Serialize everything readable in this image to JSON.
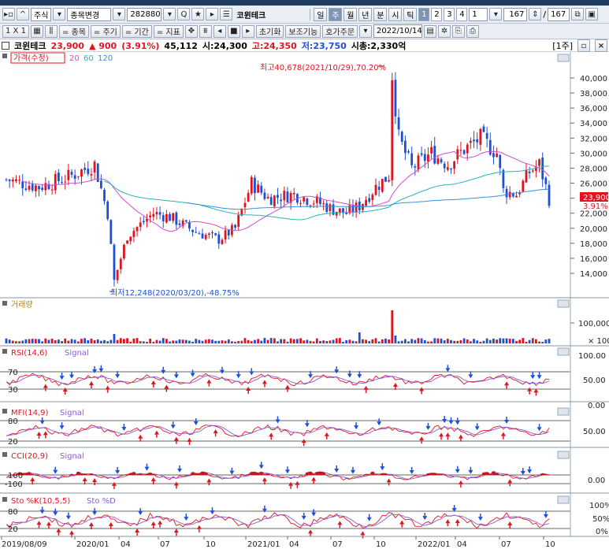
{
  "toolbar1": {
    "market": "주식",
    "search_label": "종목변경",
    "code": "282880",
    "stock_name": "코윈테크",
    "periods": [
      "일",
      "주",
      "월",
      "년",
      "분",
      "시",
      "틱"
    ],
    "active_period": "주",
    "nums": [
      "1",
      "2",
      "3",
      "4"
    ],
    "num_value": "1",
    "count_value": "167",
    "count_total": "167"
  },
  "toolbar2": {
    "ratio": "1 X 1",
    "item_btn": "= 종목",
    "period_btn": "= 주기",
    "range_btn": "= 기간",
    "indicator_btn": "= 지표",
    "reset_btn": "초기화",
    "aux_btn": "보조기능",
    "order_btn": "호가주문",
    "date_value": "2022/10/14"
  },
  "infobar": {
    "name": "코윈테크",
    "price": "23,900",
    "change": "▲ 900",
    "pct": "(3.91%)",
    "volume": "45,112",
    "open": "시:24,300",
    "high": "고:24,350",
    "low": "저:23,750",
    "mcap": "시총:2,330억",
    "period_tag": "[1주]"
  },
  "price_panel": {
    "legend_price": "가격(수정)",
    "ma": [
      "20",
      "60",
      "120"
    ],
    "max_annotation": "최고40,678(2021/10/29),70.20%",
    "min_annotation": "최저12,248(2020/03/20),-48.75%",
    "last_price": "23,900",
    "last_pct": "3.91%",
    "yticks": [
      "40,000",
      "38,000",
      "36,000",
      "34,000",
      "32,000",
      "30,000",
      "28,000",
      "26,000",
      "24,000",
      "22,000",
      "20,000",
      "18,000",
      "16,000",
      "14,000"
    ]
  },
  "volume_panel": {
    "legend": "거래량",
    "yticks": [
      "100,000",
      "× 100"
    ]
  },
  "rsi_panel": {
    "legend": "RSI(14,6)",
    "signal": "Signal",
    "levels": [
      "70",
      "30"
    ],
    "yticks": [
      "100.00",
      "50.00",
      "0.00"
    ]
  },
  "mfi_panel": {
    "legend": "MFI(14,9)",
    "signal": "Signal",
    "levels": [
      "80",
      "20"
    ],
    "yticks": [
      "50.00"
    ]
  },
  "cci_panel": {
    "legend": "CCI(20,9)",
    "signal": "Signal",
    "levels": [
      "100",
      "-100"
    ],
    "yticks": [
      "0.00"
    ]
  },
  "sto_panel": {
    "legend": "Sto %K(10,5,5)",
    "signal": "Sto %D",
    "levels": [
      "80",
      "20"
    ],
    "yticks": [
      "100%",
      "50%",
      "0%"
    ]
  },
  "xaxis": [
    "2019/08/09",
    "2020/01",
    "04",
    "07",
    "10",
    "2021/01",
    "04",
    "07",
    "10",
    "2022/01",
    "04",
    "07",
    "10"
  ],
  "colors": {
    "up": "#e0141e",
    "down": "#1d4fd8",
    "ma20": "#d24bd2",
    "ma60": "#2bb3b3",
    "ma120": "#3a8fdc",
    "toolbar": "#e9eef5"
  }
}
